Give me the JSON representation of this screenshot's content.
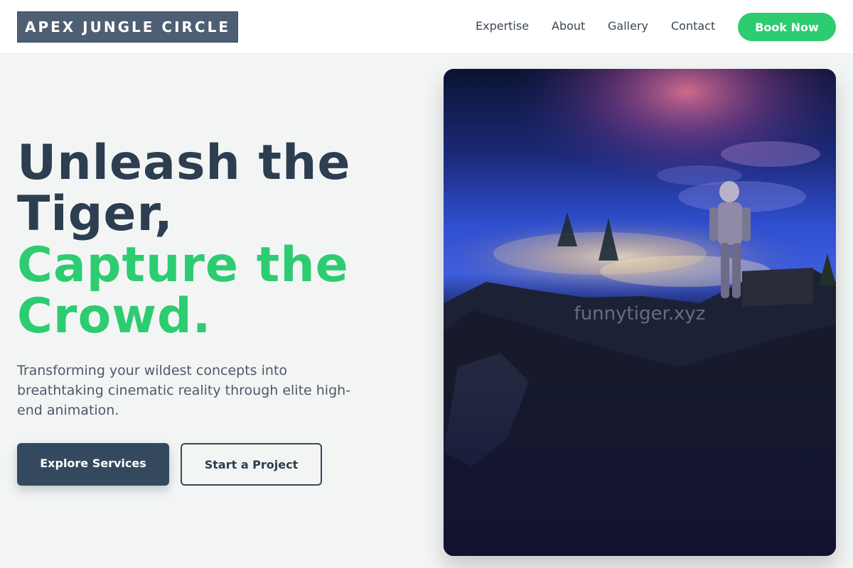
{
  "header": {
    "logo_text": "APEX JUNGLE CIRCLE",
    "nav": [
      {
        "label": "Expertise"
      },
      {
        "label": "About"
      },
      {
        "label": "Gallery"
      },
      {
        "label": "Contact"
      }
    ],
    "cta_label": "Book Now"
  },
  "hero": {
    "headline_line1": "Unleash the",
    "headline_line2": "Tiger,",
    "headline_line3": "Capture the",
    "headline_line4": "Crowd.",
    "subtext": "Transforming your wildest concepts into breathtaking cinematic reality through elite high-end animation.",
    "primary_button": "Explore Services",
    "secondary_button": "Start a Project",
    "image_watermark": "funnytiger.xyz"
  },
  "colors": {
    "accent": "#2ecc71",
    "dark": "#2c3e50",
    "logo_bg": "#4f5f73",
    "page_bg": "#f3f5f5"
  }
}
